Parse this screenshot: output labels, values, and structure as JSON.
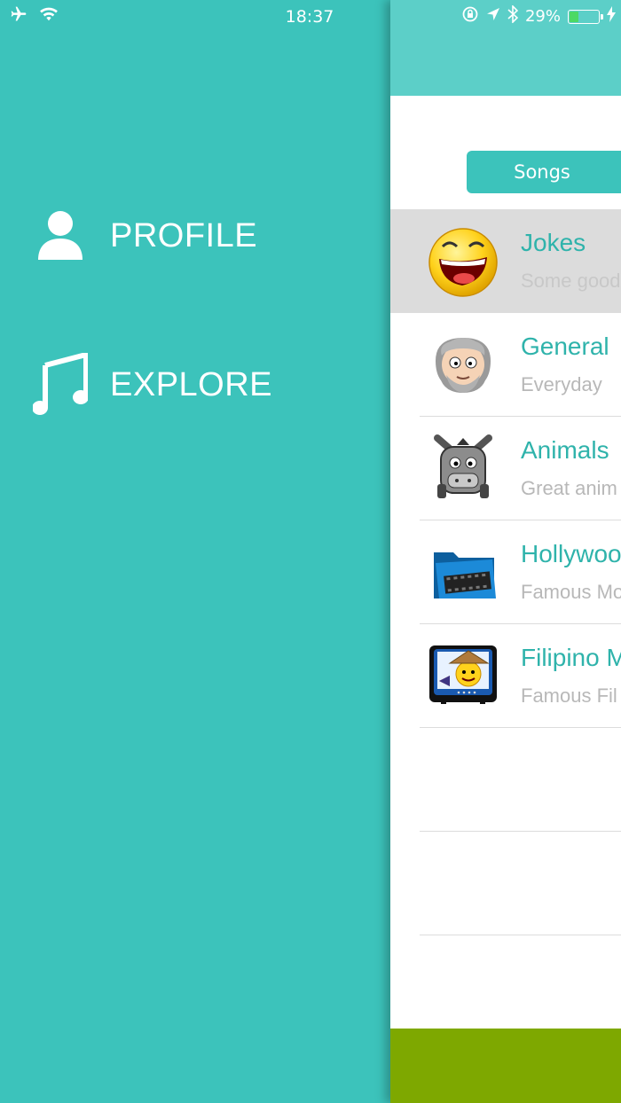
{
  "status_bar": {
    "time": "18:37",
    "battery": "29%",
    "battery_level": 0.29,
    "icons": [
      "airplane-icon",
      "wifi-icon",
      "rotation-lock-icon",
      "location-icon",
      "bluetooth-icon",
      "battery-icon",
      "charging-icon"
    ]
  },
  "menu": {
    "items": [
      {
        "label": "PROFILE",
        "icon": "person-icon"
      },
      {
        "label": "EXPLORE",
        "icon": "music-note-icon"
      }
    ]
  },
  "panel": {
    "segment_label": "Songs",
    "categories": [
      {
        "title": "Jokes",
        "subtitle": "Some good",
        "icon": "laughing-face-icon",
        "selected": true
      },
      {
        "title": "General",
        "subtitle": "Everyday",
        "icon": "old-man-face-icon"
      },
      {
        "title": "Animals",
        "subtitle": "Great anim",
        "icon": "donkey-icon"
      },
      {
        "title": "Hollywood",
        "subtitle": "Famous Mo",
        "icon": "film-folder-icon"
      },
      {
        "title": "Filipino M",
        "subtitle": "Famous Fil",
        "icon": "filipino-tv-icon"
      }
    ]
  },
  "colors": {
    "accent": "#3cc3bb",
    "nav": "#5ccfc8",
    "title_text": "#2fb3ab",
    "bottom_bar": "#7ea800"
  }
}
